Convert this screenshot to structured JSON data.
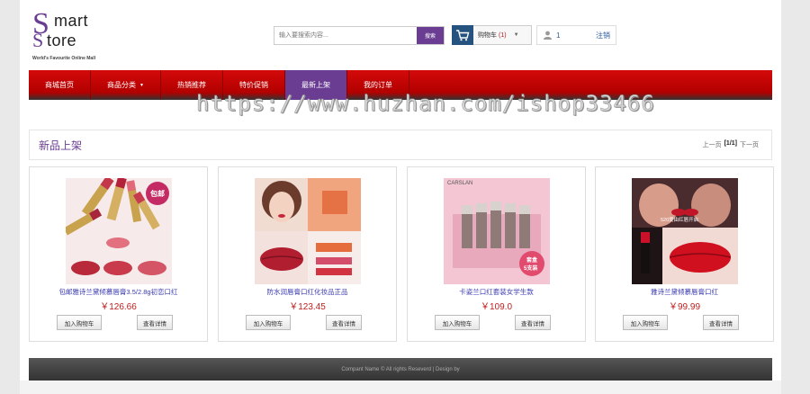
{
  "logo": {
    "s1": "S",
    "w1": "mart",
    "s2": "S",
    "w2": "tore",
    "tagline": "World's Favourite Online Mall"
  },
  "search": {
    "placeholder": "输入要搜索内容...",
    "button": "搜索"
  },
  "cart": {
    "icon": "cart-icon",
    "label": "购物车",
    "count": "(1)"
  },
  "user": {
    "icon": "user-icon",
    "number": "1",
    "logout": "注销"
  },
  "nav": {
    "items": [
      {
        "label": "商城首页"
      },
      {
        "label": "商品分类"
      },
      {
        "label": "热销推荐"
      },
      {
        "label": "特价促销"
      },
      {
        "label": "最新上架"
      },
      {
        "label": "我的订单"
      }
    ],
    "active_index": 4,
    "accent": "#d40a0a",
    "active_color": "#6a3d93"
  },
  "watermark": "https://www.huzhan.com/ishop33466",
  "section": {
    "title": "新品上架",
    "prev": "上一页",
    "page": "[1/1]",
    "next": "下一页"
  },
  "products": [
    {
      "name": "包邮雅诗兰黛倾慕唇膏3.5/2.8g初恋口红",
      "price": "￥126.66",
      "add": "加入购物车",
      "detail": "查看详情",
      "badge": "包邮"
    },
    {
      "name": "防水润唇膏口红化妆品正品",
      "price": "￥123.45",
      "add": "加入购物车",
      "detail": "查看详情"
    },
    {
      "name": "卡姿兰口红套装女学生款",
      "price": "￥109.0",
      "add": "加入购物车",
      "detail": "查看详情",
      "brand": "CARSLAN",
      "box_label": "套盒",
      "box_sub": "5支装"
    },
    {
      "name": "雅诗兰黛倾慕唇膏口红",
      "price": "￥99.99",
      "add": "加入购物车",
      "detail": "查看详情",
      "caption": "520爱由红唇开启"
    }
  ],
  "footer": "Compant Name © All rights Reseverd | Design by"
}
